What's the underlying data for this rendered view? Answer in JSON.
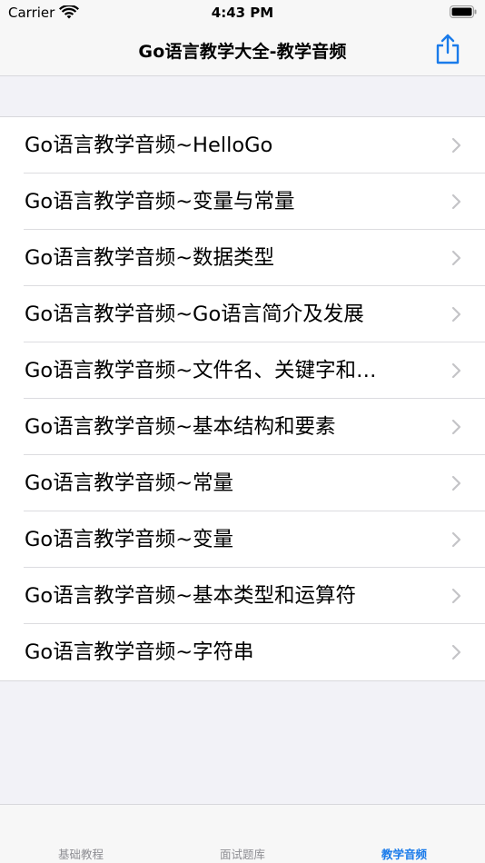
{
  "status_bar": {
    "carrier": "Carrier",
    "time": "4:43 PM"
  },
  "nav": {
    "title": "Go语言教学大全-教学音频",
    "share_icon": "share-icon"
  },
  "list": {
    "items": [
      {
        "label": "Go语言教学音频~HelloGo"
      },
      {
        "label": "Go语言教学音频~变量与常量"
      },
      {
        "label": "Go语言教学音频~数据类型"
      },
      {
        "label": "Go语言教学音频~Go语言简介及发展"
      },
      {
        "label": "Go语言教学音频~文件名、关键字和…"
      },
      {
        "label": "Go语言教学音频~基本结构和要素"
      },
      {
        "label": "Go语言教学音频~常量"
      },
      {
        "label": "Go语言教学音频~变量"
      },
      {
        "label": "Go语言教学音频~基本类型和运算符"
      },
      {
        "label": "Go语言教学音频~字符串"
      }
    ]
  },
  "tab_bar": {
    "tabs": [
      {
        "label": "基础教程",
        "active": false
      },
      {
        "label": "面试题库",
        "active": false
      },
      {
        "label": "教学音频",
        "active": true
      }
    ]
  },
  "colors": {
    "accent": "#1a7bea",
    "inactive_tab": "#8e8e93",
    "background": "#f2f2f7"
  }
}
